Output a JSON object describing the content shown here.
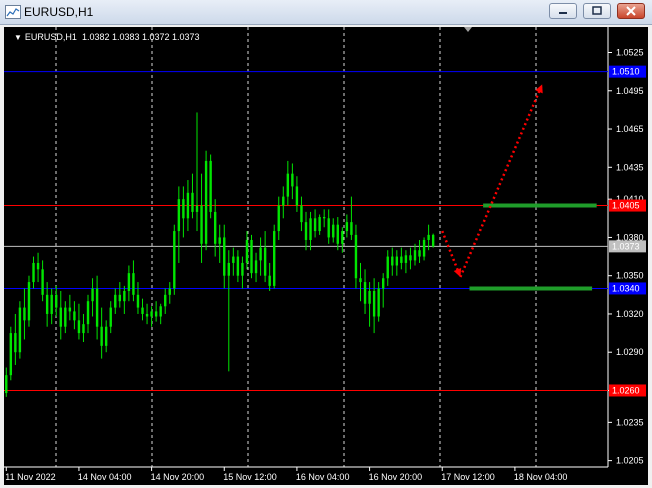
{
  "window": {
    "title": "EURUSD,H1"
  },
  "chart_header": {
    "symbol_timeframe": "EURUSD,H1",
    "ohlc": "1.0382 1.0383 1.0372 1.0373"
  },
  "colors": {
    "background": "#000000",
    "candle_up": "#00e600",
    "candle_down": "#00e600",
    "grid": "#ffffff",
    "red_line": "#ff0000",
    "blue_line": "#0000ff",
    "current_line": "#c0c0c0",
    "green_level": "#1f9d2a",
    "arrow": "#ff0000",
    "axis_text": "#ffffff"
  },
  "chart_data": {
    "type": "candlestick",
    "symbol": "EURUSD",
    "timeframe": "H1",
    "ylim": [
      1.02,
      1.0545
    ],
    "y_ticks": [
      "1.0525",
      "1.0495",
      "1.0465",
      "1.0435",
      "1.0410",
      "1.0380",
      "1.0350",
      "1.0320",
      "1.0290",
      "1.0260",
      "1.0235",
      "1.0205"
    ],
    "x_ticks": [
      "11 Nov 2022",
      "14 Nov 04:00",
      "14 Nov 20:00",
      "15 Nov 12:00",
      "16 Nov 04:00",
      "16 Nov 20:00",
      "17 Nov 12:00",
      "18 Nov 04:00"
    ],
    "horizontal_lines": [
      {
        "price": 1.051,
        "label": "1.0510",
        "color": "#0000ff"
      },
      {
        "price": 1.0405,
        "label": "1.0405",
        "color": "#ff0000"
      },
      {
        "price": 1.0373,
        "label": "1.0373",
        "color": "#c0c0c0"
      },
      {
        "price": 1.034,
        "label": "1.0340",
        "color": "#0000ff"
      },
      {
        "price": 1.026,
        "label": "1.0260",
        "color": "#ff0000"
      }
    ],
    "green_levels": [
      {
        "price": 1.0405,
        "bar_start": 105,
        "bar_end": 130
      },
      {
        "price": 1.034,
        "bar_start": 102,
        "bar_end": 129
      }
    ],
    "arrow_path": [
      {
        "bar": 96,
        "price": 1.0385
      },
      {
        "bar": 100,
        "price": 1.0349
      },
      {
        "bar": 118,
        "price": 1.05
      }
    ],
    "candles": [
      [
        1.0258,
        1.0278,
        1.0255,
        1.0272
      ],
      [
        1.0272,
        1.031,
        1.0268,
        1.0305
      ],
      [
        1.0305,
        1.032,
        1.028,
        1.029
      ],
      [
        1.029,
        1.033,
        1.0285,
        1.0325
      ],
      [
        1.0325,
        1.034,
        1.03,
        1.0315
      ],
      [
        1.0315,
        1.035,
        1.031,
        1.0345
      ],
      [
        1.0345,
        1.0365,
        1.034,
        1.036
      ],
      [
        1.036,
        1.0368,
        1.0345,
        1.0355
      ],
      [
        1.0355,
        1.0362,
        1.033,
        1.0335
      ],
      [
        1.0335,
        1.0345,
        1.031,
        1.032
      ],
      [
        1.032,
        1.034,
        1.0312,
        1.0335
      ],
      [
        1.0335,
        1.0342,
        1.0318,
        1.0325
      ],
      [
        1.0325,
        1.0338,
        1.03,
        1.031
      ],
      [
        1.031,
        1.033,
        1.0305,
        1.0325
      ],
      [
        1.0325,
        1.0335,
        1.0315,
        1.0322
      ],
      [
        1.0322,
        1.033,
        1.0308,
        1.0315
      ],
      [
        1.0315,
        1.0328,
        1.03,
        1.0305
      ],
      [
        1.0305,
        1.032,
        1.0298,
        1.0312
      ],
      [
        1.0312,
        1.0335,
        1.0305,
        1.033
      ],
      [
        1.033,
        1.0348,
        1.0318,
        1.034
      ],
      [
        1.034,
        1.035,
        1.03,
        1.031
      ],
      [
        1.031,
        1.0325,
        1.0285,
        1.0295
      ],
      [
        1.0295,
        1.0315,
        1.029,
        1.031
      ],
      [
        1.031,
        1.033,
        1.0305,
        1.0325
      ],
      [
        1.0325,
        1.034,
        1.032,
        1.0335
      ],
      [
        1.0335,
        1.0345,
        1.0325,
        1.033
      ],
      [
        1.033,
        1.0342,
        1.032,
        1.0338
      ],
      [
        1.0338,
        1.0358,
        1.033,
        1.0352
      ],
      [
        1.0352,
        1.0362,
        1.033,
        1.0335
      ],
      [
        1.0335,
        1.0345,
        1.032,
        1.0325
      ],
      [
        1.0325,
        1.0332,
        1.0315,
        1.032
      ],
      [
        1.032,
        1.0328,
        1.0312,
        1.0318
      ],
      [
        1.0318,
        1.0326,
        1.031,
        1.0322
      ],
      [
        1.0322,
        1.033,
        1.0314,
        1.0318
      ],
      [
        1.0318,
        1.0328,
        1.0312,
        1.0326
      ],
      [
        1.0326,
        1.034,
        1.032,
        1.0335
      ],
      [
        1.0335,
        1.0345,
        1.0328,
        1.034
      ],
      [
        1.034,
        1.039,
        1.0335,
        1.0385
      ],
      [
        1.0385,
        1.042,
        1.036,
        1.041
      ],
      [
        1.041,
        1.042,
        1.038,
        1.0395
      ],
      [
        1.0395,
        1.0425,
        1.0385,
        1.0415
      ],
      [
        1.0415,
        1.043,
        1.0395,
        1.04
      ],
      [
        1.04,
        1.0478,
        1.0385,
        1.0405
      ],
      [
        1.0405,
        1.043,
        1.036,
        1.0375
      ],
      [
        1.0375,
        1.0448,
        1.037,
        1.044
      ],
      [
        1.044,
        1.0445,
        1.0395,
        1.04
      ],
      [
        1.04,
        1.041,
        1.0365,
        1.0375
      ],
      [
        1.0375,
        1.039,
        1.036,
        1.038
      ],
      [
        1.038,
        1.039,
        1.034,
        1.035
      ],
      [
        1.035,
        1.037,
        1.0275,
        1.036
      ],
      [
        1.036,
        1.0372,
        1.035,
        1.0365
      ],
      [
        1.0365,
        1.037,
        1.0345,
        1.035
      ],
      [
        1.035,
        1.0365,
        1.034,
        1.036
      ],
      [
        1.036,
        1.0385,
        1.0355,
        1.0378
      ],
      [
        1.0378,
        1.0382,
        1.0348,
        1.0352
      ],
      [
        1.0352,
        1.0368,
        1.0345,
        1.0362
      ],
      [
        1.0362,
        1.038,
        1.035,
        1.0372
      ],
      [
        1.0372,
        1.0385,
        1.0345,
        1.035
      ],
      [
        1.035,
        1.036,
        1.0338,
        1.0342
      ],
      [
        1.0342,
        1.039,
        1.034,
        1.0385
      ],
      [
        1.0385,
        1.0412,
        1.0378,
        1.0405
      ],
      [
        1.0405,
        1.042,
        1.0395,
        1.0412
      ],
      [
        1.0412,
        1.044,
        1.0405,
        1.043
      ],
      [
        1.043,
        1.0438,
        1.041,
        1.042
      ],
      [
        1.042,
        1.0428,
        1.04,
        1.0405
      ],
      [
        1.0405,
        1.0412,
        1.0385,
        1.0392
      ],
      [
        1.0392,
        1.04,
        1.037,
        1.0378
      ],
      [
        1.0378,
        1.04,
        1.037,
        1.0395
      ],
      [
        1.0395,
        1.0402,
        1.038,
        1.0385
      ],
      [
        1.0385,
        1.0398,
        1.0382,
        1.0396
      ],
      [
        1.0396,
        1.0402,
        1.0388,
        1.0395
      ],
      [
        1.0395,
        1.0402,
        1.0375,
        1.038
      ],
      [
        1.038,
        1.0395,
        1.0376,
        1.039
      ],
      [
        1.039,
        1.0396,
        1.037,
        1.0375
      ],
      [
        1.0375,
        1.0388,
        1.0368,
        1.0385
      ],
      [
        1.0385,
        1.0398,
        1.038,
        1.0392
      ],
      [
        1.0392,
        1.0412,
        1.0378,
        1.0382
      ],
      [
        1.0382,
        1.039,
        1.034,
        1.0348
      ],
      [
        1.0348,
        1.036,
        1.033,
        1.0345
      ],
      [
        1.0345,
        1.0355,
        1.032,
        1.0328
      ],
      [
        1.0328,
        1.0345,
        1.031,
        1.0338
      ],
      [
        1.0338,
        1.0348,
        1.0305,
        1.0318
      ],
      [
        1.0318,
        1.0345,
        1.0314,
        1.034
      ],
      [
        1.034,
        1.0352,
        1.0325,
        1.0348
      ],
      [
        1.0348,
        1.037,
        1.0342,
        1.0365
      ],
      [
        1.0365,
        1.0372,
        1.035,
        1.0358
      ],
      [
        1.0358,
        1.037,
        1.035,
        1.0365
      ],
      [
        1.0365,
        1.0372,
        1.0355,
        1.036
      ],
      [
        1.036,
        1.037,
        1.0352,
        1.0366
      ],
      [
        1.0366,
        1.0372,
        1.0355,
        1.0362
      ],
      [
        1.0362,
        1.0375,
        1.0358,
        1.037
      ],
      [
        1.037,
        1.0378,
        1.036,
        1.0365
      ],
      [
        1.0365,
        1.038,
        1.0362,
        1.0378
      ],
      [
        1.0378,
        1.039,
        1.037,
        1.0382
      ],
      [
        1.0382,
        1.0383,
        1.0372,
        1.0373
      ]
    ]
  }
}
